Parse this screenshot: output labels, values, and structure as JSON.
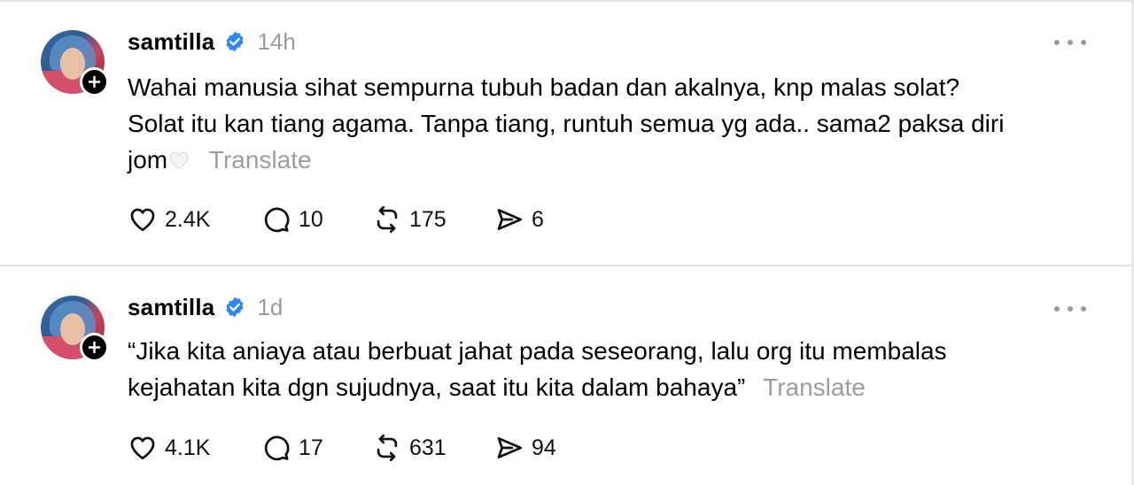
{
  "posts": [
    {
      "username": "samtilla",
      "time": "14h",
      "text_lines": [
        "Wahai manusia sihat sempurna tubuh badan dan akalnya, knp malas solat?",
        "Solat itu kan tiang agama. Tanpa tiang, runtuh semua yg ada.. sama2 paksa diri",
        "jom"
      ],
      "translate_label": "Translate",
      "likes": "2.4K",
      "replies": "10",
      "reposts": "175",
      "shares": "6"
    },
    {
      "username": "samtilla",
      "time": "1d",
      "text_lines": [
        "“Jika kita aniaya atau berbuat jahat pada seseorang, lalu org itu membalas",
        "kejahatan kita dgn sujudnya, saat itu kita dalam bahaya”"
      ],
      "translate_label": "Translate",
      "likes": "4.1K",
      "replies": "17",
      "reposts": "631",
      "shares": "94"
    }
  ],
  "icons": {
    "verified": "verified-badge-icon",
    "more": "more-options-icon",
    "follow": "plus-icon",
    "like": "heart-icon",
    "reply": "comment-bubble-icon",
    "repost": "repost-icon",
    "share": "send-icon",
    "emoji": "white-heart-emoji"
  },
  "colors": {
    "verified": "#2f88f0",
    "muted": "#9a9a9a"
  }
}
